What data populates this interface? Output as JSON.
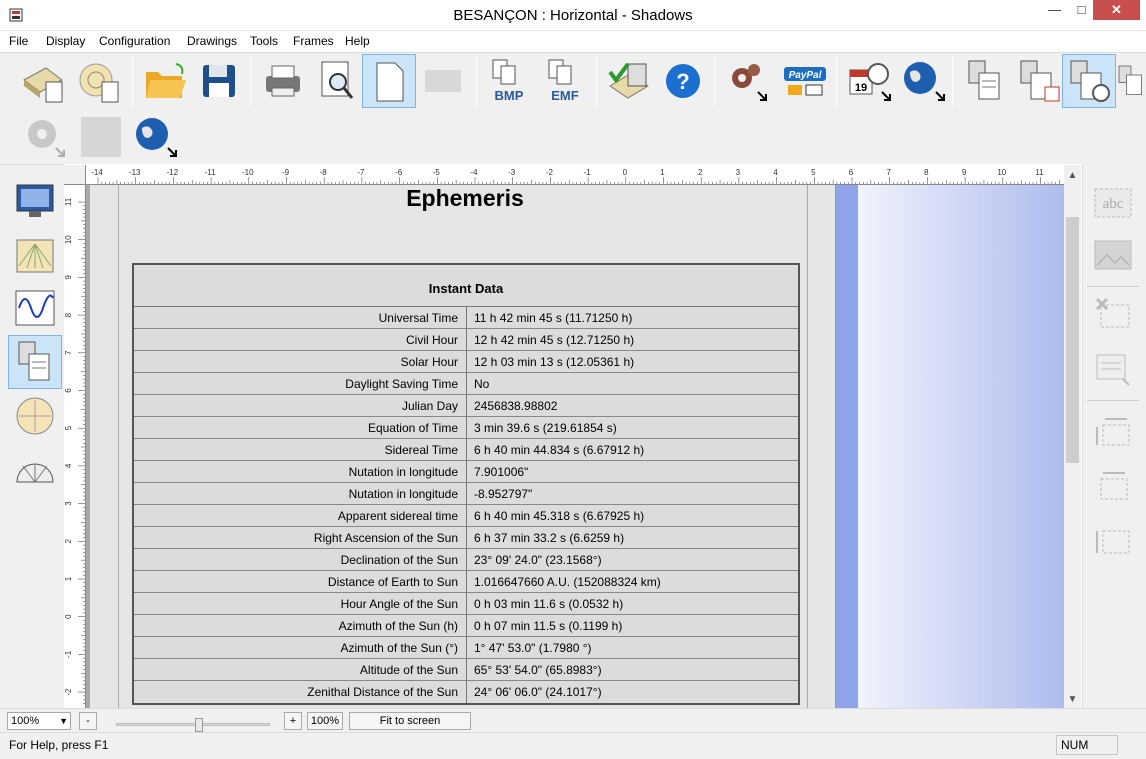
{
  "window": {
    "title": "BESANÇON : Horizontal - Shadows"
  },
  "menu": [
    "File",
    "Display",
    "Configuration",
    "Drawings",
    "Tools",
    "Frames",
    "Help"
  ],
  "toolbar": {
    "bmp_label": "BMP",
    "emf_label": "EMF",
    "paypal_label": "PayPal",
    "calendar_day": "19"
  },
  "ephemeris": {
    "title": "Ephemeris",
    "table_header": "Instant Data",
    "rows": [
      {
        "label": "Universal Time",
        "value": "11 h 42 min 45 s (11.71250 h)"
      },
      {
        "label": "Civil Hour",
        "value": "12 h 42 min 45 s (12.71250 h)"
      },
      {
        "label": "Solar Hour",
        "value": "12 h 03 min 13 s (12.05361 h)"
      },
      {
        "label": "Daylight Saving Time",
        "value": "No"
      },
      {
        "label": "Julian Day",
        "value": "2456838.98802"
      },
      {
        "label": "Equation of Time",
        "value": "3 min 39.6 s (219.61854 s)"
      },
      {
        "label": "Sidereal Time",
        "value": "6 h 40 min 44.834 s (6.67912 h)"
      },
      {
        "label": "Nutation in longitude",
        "value": "7.901006\""
      },
      {
        "label": "Nutation in longitude",
        "value": "-8.952797\""
      },
      {
        "label": "Apparent sidereal time",
        "value": "6 h 40 min 45.318 s (6.67925 h)"
      },
      {
        "label": "Right Ascension of the Sun",
        "value": "6 h 37 min 33.2 s (6.6259 h)"
      },
      {
        "label": "Declination of the Sun",
        "value": "23° 09' 24.0\" (23.1568°)"
      },
      {
        "label": "Distance of Earth to Sun",
        "value": "1.016647660 A.U. (152088324 km)"
      },
      {
        "label": "Hour Angle of the Sun",
        "value": "0 h 03 min 11.6 s (0.0532 h)"
      },
      {
        "label": "Azimuth of the Sun (h)",
        "value": "0 h 07 min 11.5 s (0.1199 h)"
      },
      {
        "label": "Azimuth of the Sun (°)",
        "value": "1° 47' 53.0\" (1.7980 °)"
      },
      {
        "label": "Altitude of the Sun",
        "value": "65° 53' 54.0\" (65.8983°)"
      },
      {
        "label": "Zenithal Distance of the Sun",
        "value": "24° 06' 06.0\" (24.1017°)"
      }
    ]
  },
  "ruler": {
    "h_ticks": [
      "-14",
      "-13",
      "-12",
      "-11",
      "-10",
      "-9",
      "-8",
      "-7",
      "-6",
      "-5",
      "-4",
      "-3",
      "-2",
      "-1",
      "0",
      "1",
      "2",
      "3",
      "4",
      "5",
      "6",
      "7",
      "8",
      "9",
      "10",
      "11"
    ],
    "v_ticks": [
      "11",
      "10",
      "9",
      "8",
      "7",
      "6",
      "5",
      "4",
      "3",
      "2",
      "1",
      "0",
      "-1",
      "-2"
    ]
  },
  "zoom": {
    "value": "100%",
    "minus": "-",
    "plus": "+",
    "reset": "100%",
    "fit": "Fit to screen"
  },
  "status": {
    "help": "For Help, press F1",
    "num": "NUM"
  },
  "right_panel": {
    "abc_label": "abc"
  }
}
